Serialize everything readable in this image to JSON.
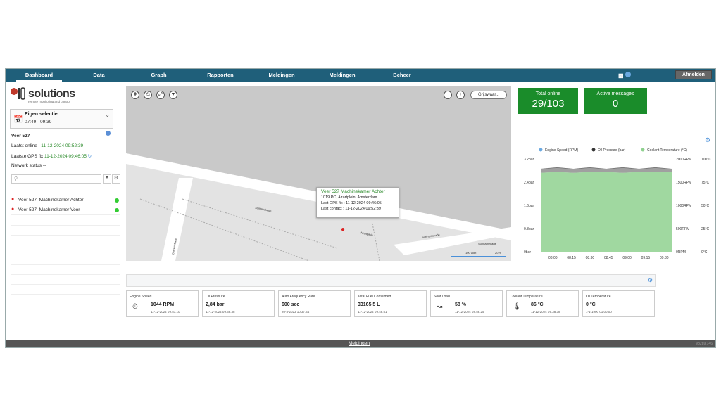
{
  "nav": {
    "items": [
      "Dashboard",
      "Data",
      "Graph",
      "Rapporten",
      "Meldingen",
      "Meldingen",
      "Beheer"
    ],
    "logout": "Afmelden"
  },
  "logo": {
    "text": "solutions",
    "mark": "101",
    "tagline": "remote monitoring and control"
  },
  "selection": {
    "title": "Eigen selectie",
    "time": "07:49 - 09:39"
  },
  "vessel": {
    "name": "Veer 527",
    "online_label": "Laatst online",
    "online_value": "11-12-2024 09:52:39",
    "gps_label": "Laatste GPS fix",
    "gps_value": "11-12-2024 09:46:05",
    "network_label": "Network status",
    "network_value": "--"
  },
  "list": [
    {
      "vessel": "Veer 527",
      "machine": "Machinekamer Achter"
    },
    {
      "vessel": "Veer 527",
      "machine": "Machinekamer Voor"
    }
  ],
  "map": {
    "layer": "Grijswaar...",
    "streets": [
      "Sumatrakade",
      "Azartplein",
      "Surinamekade",
      "Surinamekade",
      "Borneostraat"
    ],
    "popup": {
      "title": "Veer 527 Machinekamer Achter",
      "address": "1019 PC, Azartplein, Amsterdam",
      "gps": "Last GPS fix : 11-12-2024 09:46:05",
      "contact": "Last contact : 11-12-2024 09:52:39"
    },
    "scale1": "100 voet",
    "scale2": "20 m"
  },
  "kpis": [
    {
      "label": "Total online",
      "value": "29/103"
    },
    {
      "label": "Active messages",
      "value": "0"
    }
  ],
  "chart_data": {
    "type": "area",
    "x": [
      "08:00",
      "08:15",
      "08:30",
      "08:45",
      "09:00",
      "09:15",
      "09:30"
    ],
    "series": [
      {
        "name": "Engine Speed (RPM)",
        "color": "#6aa8e0",
        "range": [
          0,
          2000
        ]
      },
      {
        "name": "Oil Pressure (bar)",
        "color": "#333333",
        "values": [
          2.85,
          2.9,
          2.85,
          2.9,
          2.85,
          2.9,
          2.85,
          2.9,
          2.85
        ],
        "range": [
          0,
          3.2
        ]
      },
      {
        "name": "Coolant Temperature (°C)",
        "color": "#8fd18f",
        "values": [
          85,
          86,
          85,
          86,
          86,
          85,
          86,
          86,
          86
        ],
        "range": [
          0,
          100
        ]
      }
    ],
    "yticks_left": [
      "3.2bar",
      "2.4bar",
      "1.6bar",
      "0.8bar",
      "0bar"
    ],
    "yticks_mid": [
      "2000RPM",
      "1500RPM",
      "1000RPM",
      "500RPM",
      "0RPM"
    ],
    "yticks_right": [
      "100°C",
      "75°C",
      "50°C",
      "25°C",
      "0°C"
    ],
    "legend": "top"
  },
  "cards": [
    {
      "title": "Engine Speed",
      "value": "1044 RPM",
      "date": "11-12-2024 09:51:10",
      "icon": "gauge-icon"
    },
    {
      "title": "Oil Pressure",
      "value": "2,84 bar",
      "date": "11-12-2024 09:38:38",
      "icon": ""
    },
    {
      "title": "Auto Frequency Rate",
      "value": "600 sec",
      "date": "20-3-2023 10:37:44",
      "icon": ""
    },
    {
      "title": "Total Fuel Consumed",
      "value": "33165,5 L",
      "date": "11-12-2024 09:48:51",
      "icon": ""
    },
    {
      "title": "Soot Load",
      "value": "58 %",
      "date": "11-12-2024 08:58:25",
      "icon": "line-chart-icon"
    },
    {
      "title": "Coolant Temperature",
      "value": "86 °C",
      "date": "11-12-2024 09:38:38",
      "icon": "thermometer-icon"
    },
    {
      "title": "Oil Temperature",
      "value": "0 °C",
      "date": "1-1-1900 01:00:00",
      "icon": ""
    }
  ],
  "footer": {
    "link": "Meldingen",
    "version": "v8289.146"
  }
}
